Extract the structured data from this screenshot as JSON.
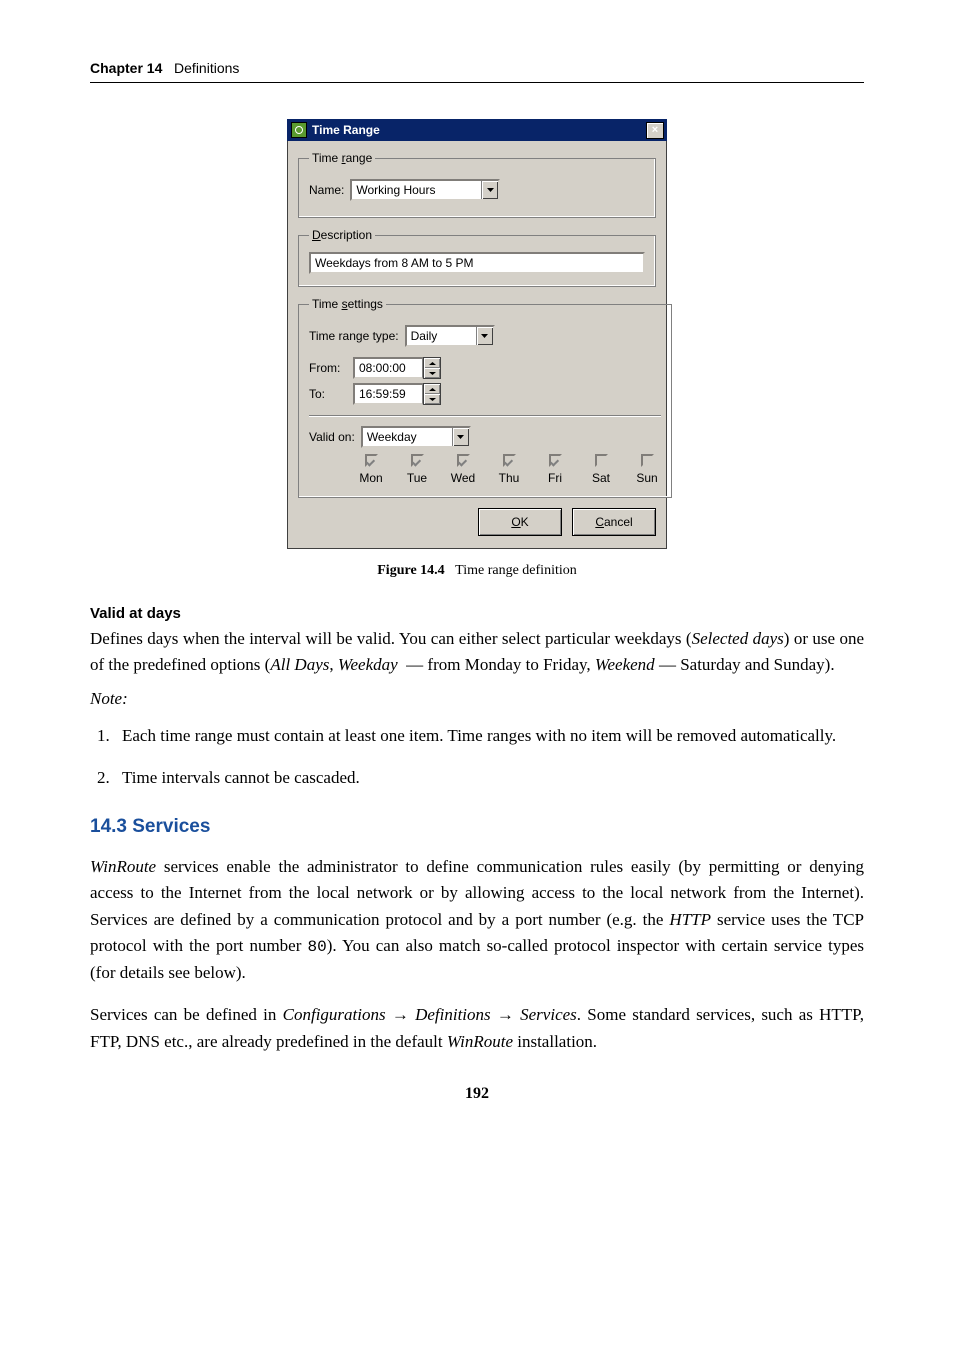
{
  "header": {
    "chapter": "Chapter 14",
    "title": "Definitions"
  },
  "dialog": {
    "title": "Time Range",
    "close_label": "×",
    "time_range_group": "Time range",
    "name_label": "Name:",
    "name_value": "Working Hours",
    "description_group": "Description",
    "description_value": "Weekdays from 8 AM to 5 PM",
    "time_settings_group": "Time settings",
    "time_range_type_label": "Time range type:",
    "time_range_type_value": "Daily",
    "from_label": "From:",
    "from_value": "08:00:00",
    "to_label": "To:",
    "to_value": "16:59:59",
    "valid_on_label": "Valid on:",
    "valid_on_value": "Weekday",
    "days": [
      {
        "label": "Mon",
        "checked": true
      },
      {
        "label": "Tue",
        "checked": true
      },
      {
        "label": "Wed",
        "checked": true
      },
      {
        "label": "Thu",
        "checked": true
      },
      {
        "label": "Fri",
        "checked": true
      },
      {
        "label": "Sat",
        "checked": false
      },
      {
        "label": "Sun",
        "checked": false
      }
    ],
    "ok_label": "OK",
    "cancel_label": "Cancel"
  },
  "caption": {
    "label": "Figure 14.4",
    "text": "Time range definition"
  },
  "valid_at_days": {
    "term": "Valid at days",
    "body": "Defines days when the interval will be valid. You can either select particular weekdays (Selected days) or use one of the predefined options (All Days, Weekday  — from Monday to Friday, Weekend — Saturday and Sunday)."
  },
  "note_label": "Note:",
  "notes": [
    "Each time range must contain at least one item. Time ranges with no item will be removed automatically.",
    "Time intervals cannot be cascaded."
  ],
  "section": {
    "heading": "14.3  Services"
  },
  "services_p1": "WinRoute services enable the administrator to define communication rules easily (by permitting or denying access to the Internet from the local network or by allowing access to the local network from the Internet). Services are defined by a communication protocol and by a port number (e.g. the HTTP service uses the TCP protocol with the port number 80). You can also match so-called protocol inspector with certain service types (for details see below).",
  "services_p2": "Services can be defined in Configurations → Definitions → Services. Some standard services, such as HTTP, FTP, DNS etc., are already predefined in the default WinRoute installation.",
  "page_number": "192"
}
